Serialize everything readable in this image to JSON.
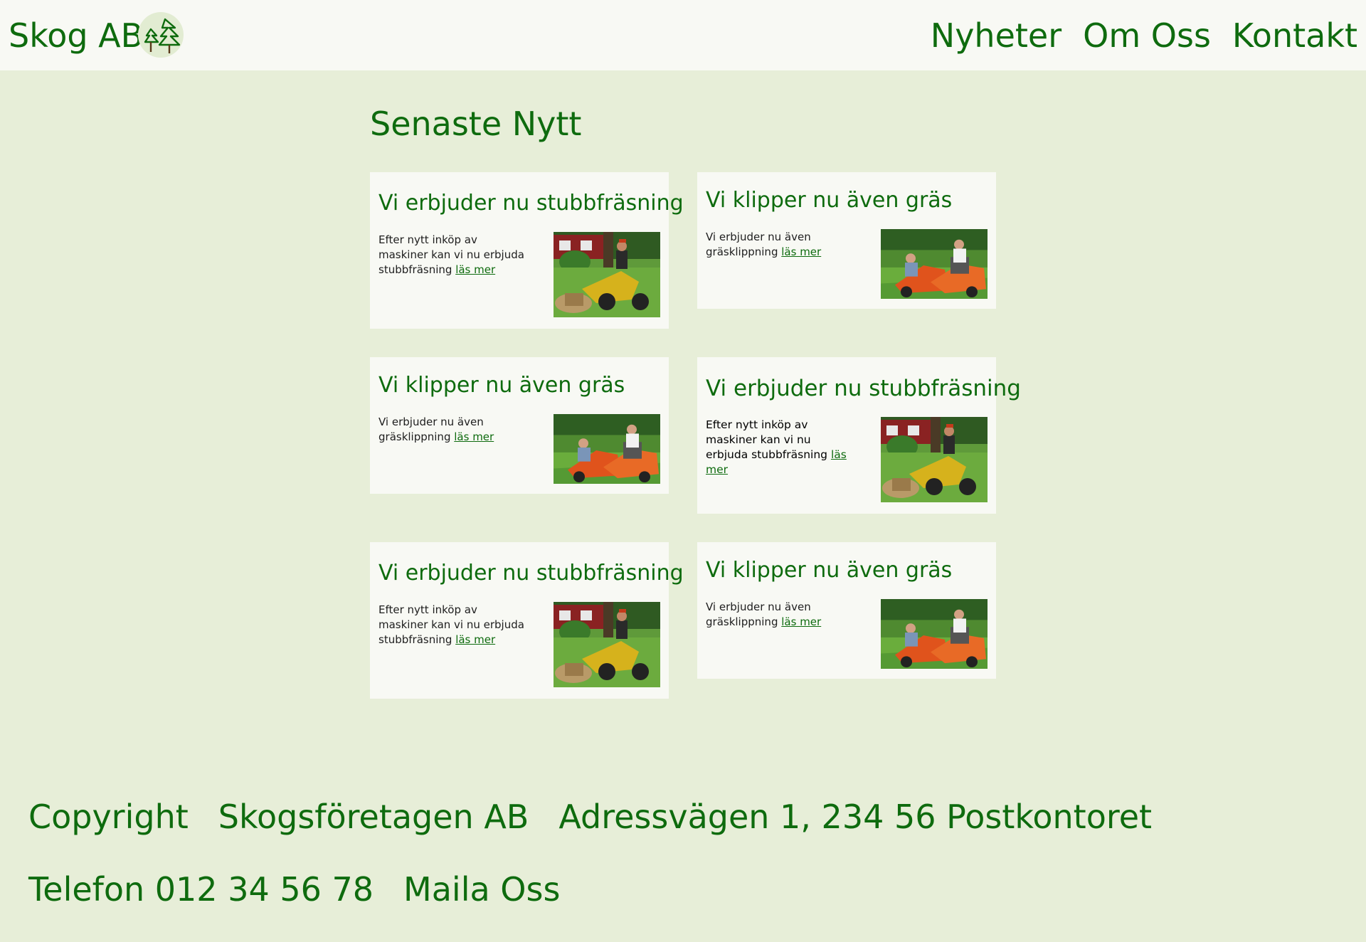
{
  "header": {
    "logo_text": "Skog AB",
    "logo_icon": "tree-logo-icon",
    "nav": [
      "Nyheter",
      "Om Oss",
      "Kontakt"
    ]
  },
  "main": {
    "title": "Senaste Nytt",
    "cards": [
      {
        "title": "Vi erbjuder nu stubbfräsning",
        "excerpt": "Efter nytt inköp av maskiner kan vi nu erbjuda stubbfräsning",
        "link": "läs mer",
        "image": "stump-grinder-photo"
      },
      {
        "title": "Vi klipper nu även gräs",
        "excerpt": "Vi erbjuder nu även gräsklippning",
        "link": "läs mer",
        "image": "lawn-mower-photo"
      },
      {
        "title": "Vi klipper nu även gräs",
        "excerpt": "Vi erbjuder nu även gräsklippning",
        "link": "läs mer",
        "image": "lawn-mower-photo"
      },
      {
        "title": "Vi erbjuder nu stubbfräsning",
        "excerpt": "Efter nytt inköp av maskiner kan vi nu erbjuda stubbfräsning",
        "link": "läs mer",
        "image": "stump-grinder-photo"
      },
      {
        "title": "Vi erbjuder nu stubbfräsning",
        "excerpt": "Efter nytt inköp av maskiner kan vi nu erbjuda stubbfräsning",
        "link": "läs mer",
        "image": "stump-grinder-photo"
      },
      {
        "title": "Vi klipper nu även gräs",
        "excerpt": "Vi erbjuder nu även gräsklippning",
        "link": "läs mer",
        "image": "lawn-mower-photo"
      }
    ]
  },
  "footer": {
    "copyright": "Copyright",
    "company": "Skogsföretagen AB",
    "address": "Adressvägen 1, 234 56 Postkontoret",
    "phone": "Telefon 012 34 56 78",
    "email_link": "Maila Oss"
  },
  "colors": {
    "page_bg": "#e7eed8",
    "header_bg": "#f8f9f4",
    "card_bg": "#f8f9f4",
    "accent_green": "#0e6b0e"
  }
}
